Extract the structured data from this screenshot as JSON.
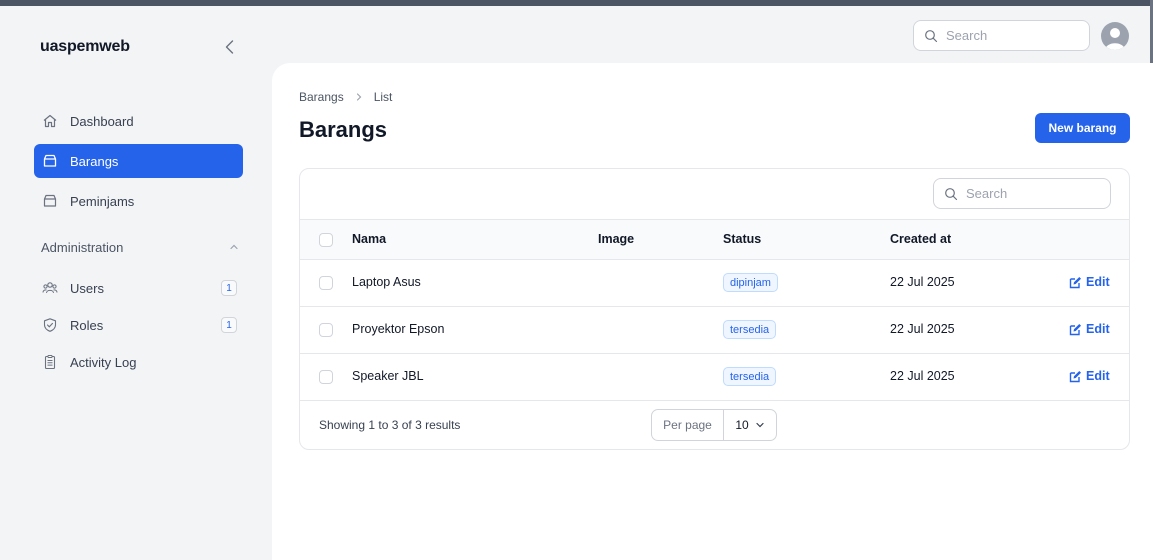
{
  "app": {
    "brand": "uaspemweb"
  },
  "topbar": {
    "search_placeholder": "Search"
  },
  "sidebar": {
    "items": [
      {
        "label": "Dashboard",
        "icon": "home-icon"
      },
      {
        "label": "Barangs",
        "icon": "archive-box-icon",
        "active": true
      },
      {
        "label": "Peminjams",
        "icon": "archive-box-icon"
      }
    ],
    "group": {
      "label": "Administration",
      "items": [
        {
          "label": "Users",
          "icon": "users-icon",
          "badge": "1"
        },
        {
          "label": "Roles",
          "icon": "shield-check-icon",
          "badge": "1"
        },
        {
          "label": "Activity Log",
          "icon": "clipboard-document-icon"
        }
      ]
    }
  },
  "main": {
    "breadcrumb": [
      "Barangs",
      "List"
    ],
    "title": "Barangs",
    "new_button": "New barang",
    "table": {
      "search_placeholder": "Search",
      "columns": [
        "Nama",
        "Image",
        "Status",
        "Created at"
      ],
      "rows": [
        {
          "nama": "Laptop Asus",
          "status": "dipinjam",
          "created_at": "22 Jul 2025",
          "action": "Edit"
        },
        {
          "nama": "Proyektor Epson",
          "status": "tersedia",
          "created_at": "22 Jul 2025",
          "action": "Edit"
        },
        {
          "nama": "Speaker JBL",
          "status": "tersedia",
          "created_at": "22 Jul 2025",
          "action": "Edit"
        }
      ],
      "footer": {
        "showing": "Showing 1 to 3 of 3 results",
        "per_page_label": "Per page",
        "per_page_value": "10"
      }
    }
  },
  "colors": {
    "accent": "#2563eb",
    "background": "#f3f4f6",
    "panel": "#ffffff"
  }
}
